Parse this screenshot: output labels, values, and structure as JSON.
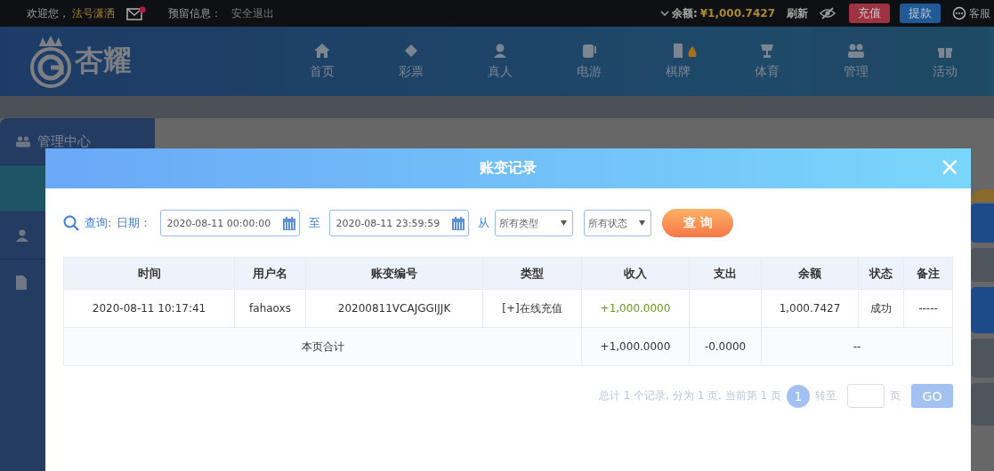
{
  "top_bar": {
    "welcome": "欢迎您，",
    "username": "法号潇洒",
    "mail_unread": true,
    "reserved_label": "预留信息：",
    "logout": "安全退出",
    "balance_label": "余额:",
    "balance": "¥1,000.7427",
    "refresh": "刷新",
    "deposit": "充值",
    "withdraw": "提款",
    "service": "客服"
  },
  "header": {
    "logo": "杏耀",
    "nav": [
      {
        "label": "首页"
      },
      {
        "label": "彩票"
      },
      {
        "label": "真人"
      },
      {
        "label": "电游"
      },
      {
        "label": "棋牌"
      },
      {
        "label": "体育"
      },
      {
        "label": "管理"
      },
      {
        "label": "活动"
      }
    ]
  },
  "sidebar": {
    "title": "管理中心",
    "items": [
      {
        "selected": true
      },
      {
        "selected": false
      },
      {
        "selected": false
      }
    ]
  },
  "dialog": {
    "title": "账变记录",
    "close": "×",
    "query": {
      "label": "查询:",
      "date_label": "日期：",
      "start": "2020-08-11 00:00:00",
      "to": "至",
      "end": "2020-08-11 23:59:59",
      "from": "从",
      "type_select": "所有类型",
      "status_select": "所有状态",
      "button": "查 询"
    },
    "table": {
      "columns": [
        "时间",
        "用户名",
        "账变编号",
        "类型",
        "收入",
        "支出",
        "余额",
        "状态",
        "备注"
      ],
      "rows": [
        {
          "kind": "record",
          "cells": [
            "2020-08-11 10:17:41",
            "fahaoxs",
            "20200811VCAJGGIJJK",
            "[+]在线充值",
            "+1,000.0000",
            "",
            "1,000.7427",
            "成功",
            "-----"
          ]
        },
        {
          "kind": "total",
          "label": "本页合计",
          "income": "+1,000.0000",
          "expense": "-0.0000",
          "rest": "--"
        }
      ]
    },
    "pagination": {
      "summary": "总计 1 个记录, 分为 1 页, 当前第 1 页",
      "pages": [
        {
          "label": "1",
          "selected": true
        }
      ],
      "goto": "转至",
      "unit": "页",
      "go": "GO"
    }
  }
}
